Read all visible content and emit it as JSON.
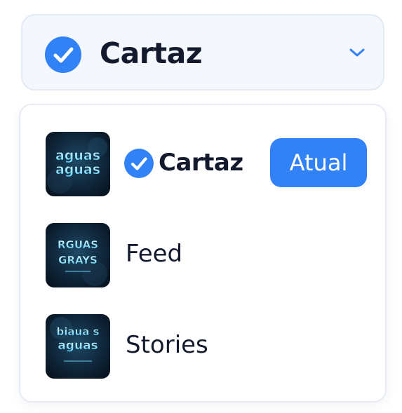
{
  "colors": {
    "accent": "#3182f6",
    "text": "#141a2e",
    "trigger_bg": "#f4f7fc",
    "border": "#e3e9f5"
  },
  "select": {
    "current_label": "Cartaz",
    "check_icon": "check-circle-icon",
    "chevron_icon": "chevron-down-icon"
  },
  "options": [
    {
      "label": "Cartaz",
      "selected": true,
      "badge": "Atual",
      "thumbnail": {
        "icon": "poster-thumbnail-icon",
        "text_lines": [
          "aguas",
          "aguas"
        ]
      }
    },
    {
      "label": "Feed",
      "selected": false,
      "thumbnail": {
        "icon": "feed-thumbnail-icon",
        "text_lines": [
          "RGUAS",
          "GRAYS"
        ]
      }
    },
    {
      "label": "Stories",
      "selected": false,
      "thumbnail": {
        "icon": "stories-thumbnail-icon",
        "text_lines": [
          "biaua s",
          "aguas"
        ]
      }
    }
  ]
}
